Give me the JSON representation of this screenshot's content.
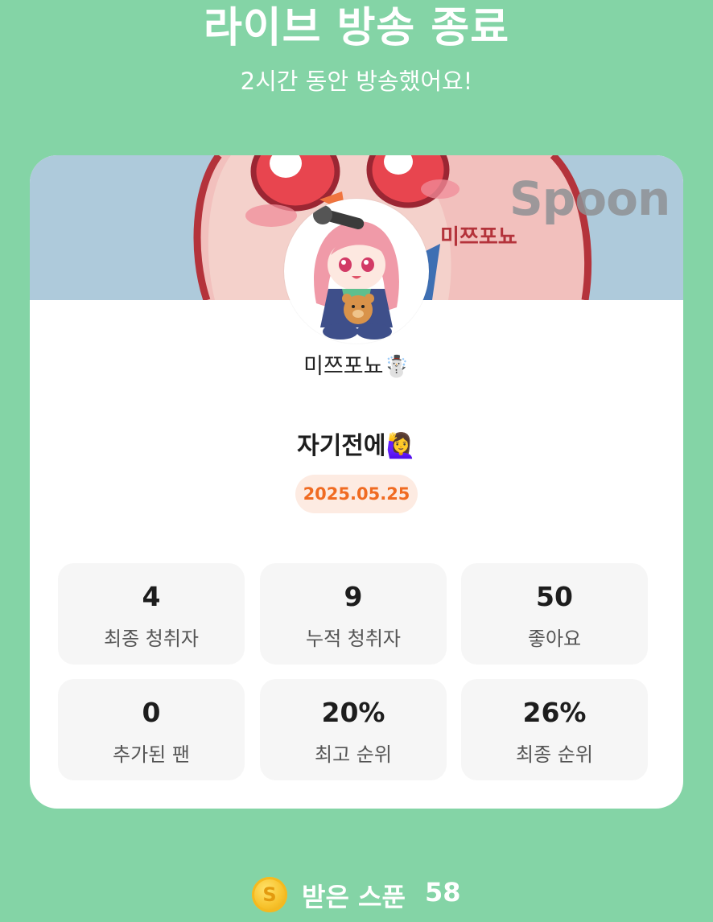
{
  "header": {
    "title": "라이브 방송 종료",
    "subtitle": "2시간 동안 방송했어요!"
  },
  "banner": {
    "logo_text": "Spoon",
    "art_text": "미쯔포뇨"
  },
  "profile": {
    "nickname": "미쯔포뇨",
    "nickname_emoji": "☃️"
  },
  "broadcast": {
    "title": "자기전에",
    "title_emoji": "🙋‍♀️",
    "date": "2025.05.25"
  },
  "stats": [
    {
      "value": "4",
      "label": "최종 청취자"
    },
    {
      "value": "9",
      "label": "누적 청취자"
    },
    {
      "value": "50",
      "label": "좋아요"
    },
    {
      "value": "0",
      "label": "추가된 팬"
    },
    {
      "value": "20%",
      "label": "최고 순위"
    },
    {
      "value": "26%",
      "label": "최종 순위"
    }
  ],
  "spoons": {
    "coin_symbol": "S",
    "label": "받은 스푼",
    "count": "58"
  },
  "colors": {
    "background": "#84d4a6",
    "date_accent": "#f06b22",
    "date_pill": "#fdebe2",
    "coin": "#f7c22c"
  }
}
